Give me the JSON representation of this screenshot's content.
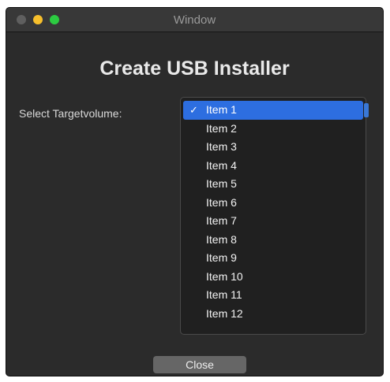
{
  "window": {
    "title": "Window"
  },
  "main": {
    "heading": "Create USB Installer",
    "select_label": "Select Targetvolume:"
  },
  "dropdown": {
    "check_glyph": "✓",
    "selected_index": 0,
    "items": [
      {
        "label": "Item 1"
      },
      {
        "label": "Item 2"
      },
      {
        "label": "Item 3"
      },
      {
        "label": "Item 4"
      },
      {
        "label": "Item 5"
      },
      {
        "label": "Item 6"
      },
      {
        "label": "Item 7"
      },
      {
        "label": "Item 8"
      },
      {
        "label": "Item 9"
      },
      {
        "label": "Item 10"
      },
      {
        "label": "Item 11"
      },
      {
        "label": "Item 12"
      }
    ]
  },
  "footer": {
    "close_label": "Close"
  },
  "colors": {
    "background": "#2b2b2b",
    "selected_highlight": "#2d6ee0",
    "close_light": "#5f5f5f",
    "minimize_light": "#f7bf2c",
    "zoom_light": "#2ccb41"
  }
}
